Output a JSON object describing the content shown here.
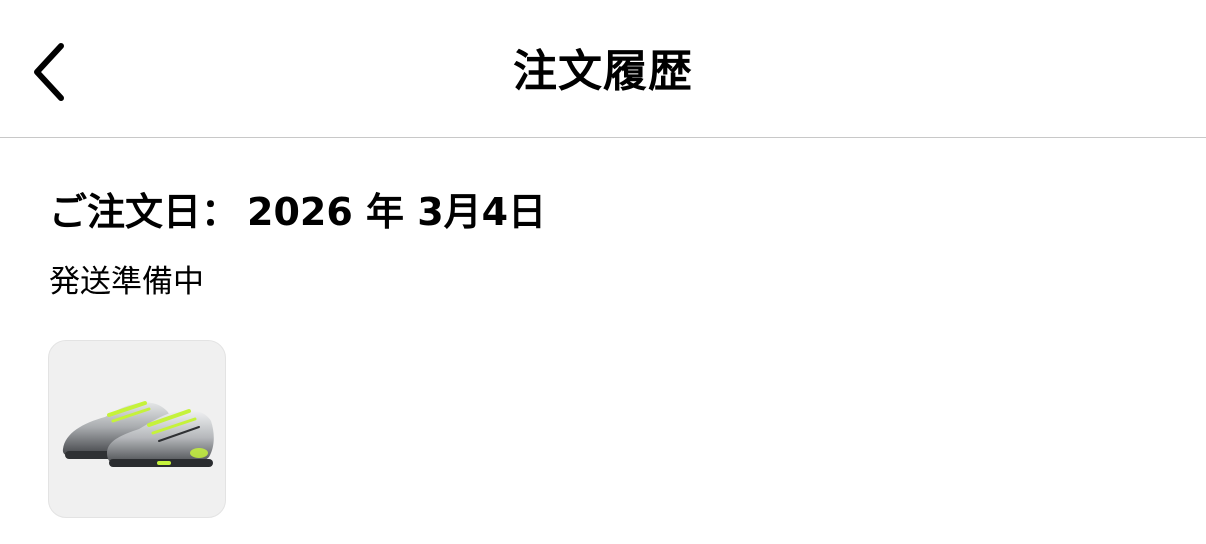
{
  "header": {
    "title": "注文履歴",
    "back_icon": "chevron-left-icon"
  },
  "order": {
    "date_label": "ご注文日：",
    "date_value": "2026 年 3月4日",
    "status": "発送準備中",
    "product": {
      "image_icon": "sneaker-product-image",
      "colors": {
        "upper_dark": "#3c3e42",
        "upper_light": "#dcdedf",
        "accent": "#c5f23b",
        "background": "#f0f0f0"
      }
    }
  }
}
